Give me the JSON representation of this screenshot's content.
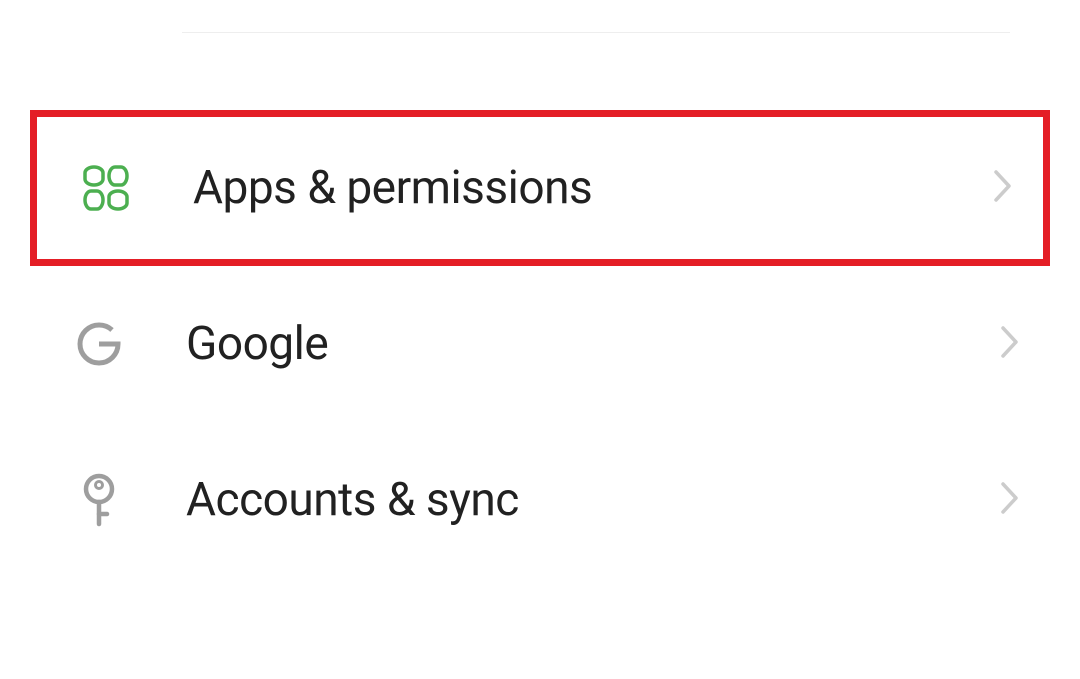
{
  "settings": {
    "items": [
      {
        "id": "apps-permissions",
        "label": "Apps & permissions",
        "icon": "apps-icon",
        "highlighted": true
      },
      {
        "id": "google",
        "label": "Google",
        "icon": "google-icon",
        "highlighted": false
      },
      {
        "id": "accounts-sync",
        "label": "Accounts & sync",
        "icon": "key-icon",
        "highlighted": false
      }
    ]
  },
  "colors": {
    "highlight_border": "#e41e26",
    "apps_icon": "#4caf50",
    "google_icon": "#9e9e9e",
    "key_icon": "#9e9e9e",
    "chevron": "#cccccc",
    "text": "#212121"
  }
}
